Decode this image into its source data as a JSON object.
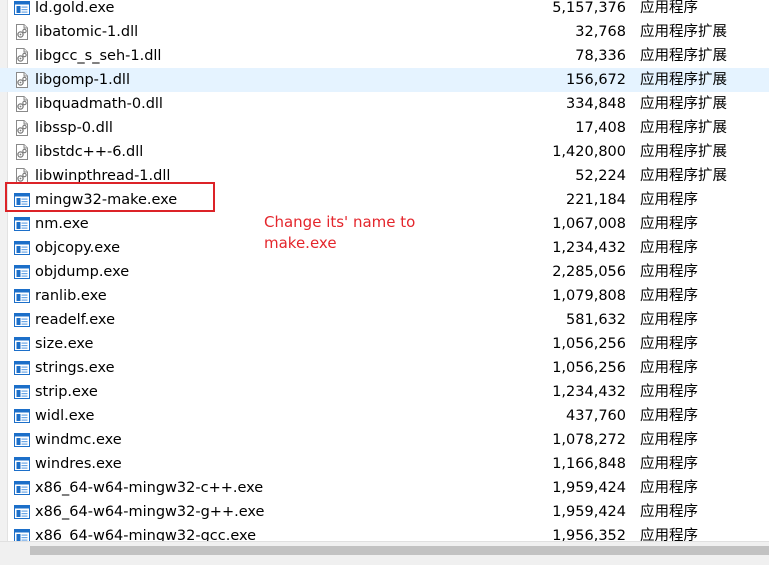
{
  "files": [
    {
      "name": "ld.gold.exe",
      "size": "5,157,376",
      "type": "应用程序",
      "icon": "exe-icon"
    },
    {
      "name": "libatomic-1.dll",
      "size": "32,768",
      "type": "应用程序扩展",
      "icon": "dll-icon"
    },
    {
      "name": "libgcc_s_seh-1.dll",
      "size": "78,336",
      "type": "应用程序扩展",
      "icon": "dll-icon"
    },
    {
      "name": "libgomp-1.dll",
      "size": "156,672",
      "type": "应用程序扩展",
      "icon": "dll-icon"
    },
    {
      "name": "libquadmath-0.dll",
      "size": "334,848",
      "type": "应用程序扩展",
      "icon": "dll-icon"
    },
    {
      "name": "libssp-0.dll",
      "size": "17,408",
      "type": "应用程序扩展",
      "icon": "dll-icon"
    },
    {
      "name": "libstdc++-6.dll",
      "size": "1,420,800",
      "type": "应用程序扩展",
      "icon": "dll-icon"
    },
    {
      "name": "libwinpthread-1.dll",
      "size": "52,224",
      "type": "应用程序扩展",
      "icon": "dll-icon"
    },
    {
      "name": "mingw32-make.exe",
      "size": "221,184",
      "type": "应用程序",
      "icon": "exe-icon"
    },
    {
      "name": "nm.exe",
      "size": "1,067,008",
      "type": "应用程序",
      "icon": "exe-icon"
    },
    {
      "name": "objcopy.exe",
      "size": "1,234,432",
      "type": "应用程序",
      "icon": "exe-icon"
    },
    {
      "name": "objdump.exe",
      "size": "2,285,056",
      "type": "应用程序",
      "icon": "exe-icon"
    },
    {
      "name": "ranlib.exe",
      "size": "1,079,808",
      "type": "应用程序",
      "icon": "exe-icon"
    },
    {
      "name": "readelf.exe",
      "size": "581,632",
      "type": "应用程序",
      "icon": "exe-icon"
    },
    {
      "name": "size.exe",
      "size": "1,056,256",
      "type": "应用程序",
      "icon": "exe-icon"
    },
    {
      "name": "strings.exe",
      "size": "1,056,256",
      "type": "应用程序",
      "icon": "exe-icon"
    },
    {
      "name": "strip.exe",
      "size": "1,234,432",
      "type": "应用程序",
      "icon": "exe-icon"
    },
    {
      "name": "widl.exe",
      "size": "437,760",
      "type": "应用程序",
      "icon": "exe-icon"
    },
    {
      "name": "windmc.exe",
      "size": "1,078,272",
      "type": "应用程序",
      "icon": "exe-icon"
    },
    {
      "name": "windres.exe",
      "size": "1,166,848",
      "type": "应用程序",
      "icon": "exe-icon"
    },
    {
      "name": "x86_64-w64-mingw32-c++.exe",
      "size": "1,959,424",
      "type": "应用程序",
      "icon": "exe-icon"
    },
    {
      "name": "x86_64-w64-mingw32-g++.exe",
      "size": "1,959,424",
      "type": "应用程序",
      "icon": "exe-icon"
    },
    {
      "name": "x86_64-w64-mingw32-gcc.exe",
      "size": "1,956,352",
      "type": "应用程序",
      "icon": "exe-icon"
    }
  ],
  "hovered_file": "libgomp-1.dll",
  "highlighted_file": "mingw32-make.exe",
  "annotation": {
    "text": "Change its' name to\nmake.exe",
    "color": "#e4262c"
  },
  "colors": {
    "highlight_box": "#dc2328",
    "hover_row": "#e5f3ff",
    "exe_icon_blue": "#1c6fc9",
    "dll_icon_gray": "#8a8a8a"
  }
}
